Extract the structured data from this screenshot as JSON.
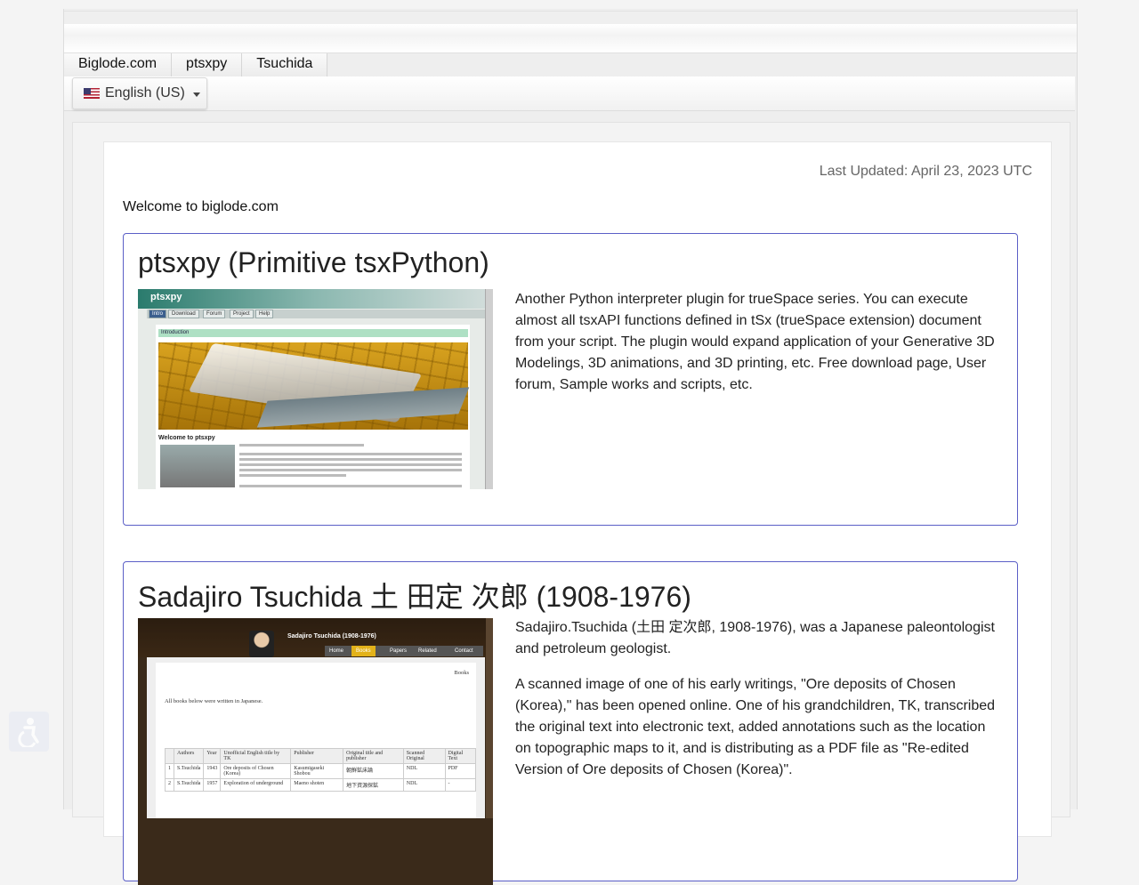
{
  "nav": {
    "tabs": [
      "Biglode.com",
      "ptsxpy",
      "Tsuchida"
    ],
    "language": "English (US)"
  },
  "page": {
    "last_updated": "Last Updated: April 23, 2023 UTC",
    "welcome": "Welcome to biglode.com"
  },
  "cards": [
    {
      "title": "ptsxpy (Primitive tsxPython)",
      "paragraphs": [
        "Another Python interpreter plugin for trueSpace series. You can execute almost all tsxAPI functions defined in tSx (trueSpace extension) document from your script. The plugin would expand application of your Generative 3D Modelings, 3D animations, and 3D printing, etc. Free download page, User forum, Sample works and scripts, etc."
      ],
      "thumb": {
        "logo": "ptsxpy",
        "nav": [
          "Intro",
          "Download",
          "Forum",
          "Project",
          "Help"
        ],
        "intro_bar": "Introduction",
        "welcome": "Welcome to ptsxpy"
      }
    },
    {
      "title": "Sadajiro Tsuchida 土 田定 次郎 (1908-1976)",
      "paragraphs": [
        "Sadajiro.Tsuchida (土田 定次郎, 1908-1976), was a Japanese paleontologist and petroleum geologist.",
        "A scanned image of one of his early writings, \"Ore deposits of Chosen (Korea),\" has been opened online. One of his grandchildren, TK, transcribed the original text into electronic text, added annotations such as the location on topographic maps to it, and is distributing as a PDF file as \"Re-edited Version of Ore deposits of Chosen (Korea)\"."
      ],
      "thumb": {
        "site_title": "Sadajiro Tsuchida (1908-1976)",
        "nav": [
          "Home",
          "Books",
          "Papers",
          "Related",
          "Contact"
        ],
        "section": "Books",
        "note": "All books below were written in Japanese.",
        "table_head": [
          "",
          "Authors",
          "Year",
          "Unofficial English title by TK",
          "Publisher",
          "Original title and publisher",
          "Scanned Original",
          "Digital Text"
        ],
        "rows": [
          [
            "1",
            "S.Tsuchida",
            "1943",
            "Ore deposits of Chosen (Korea)",
            "Kasumigaseki Shobou",
            "朝鮮鉱床論",
            "NDL",
            "PDF"
          ],
          [
            "2",
            "S.Tsuchida",
            "1957",
            "Exploration of underground",
            "Maeno shoten",
            "地下資源探鉱",
            "NDL",
            "-"
          ]
        ]
      }
    }
  ]
}
